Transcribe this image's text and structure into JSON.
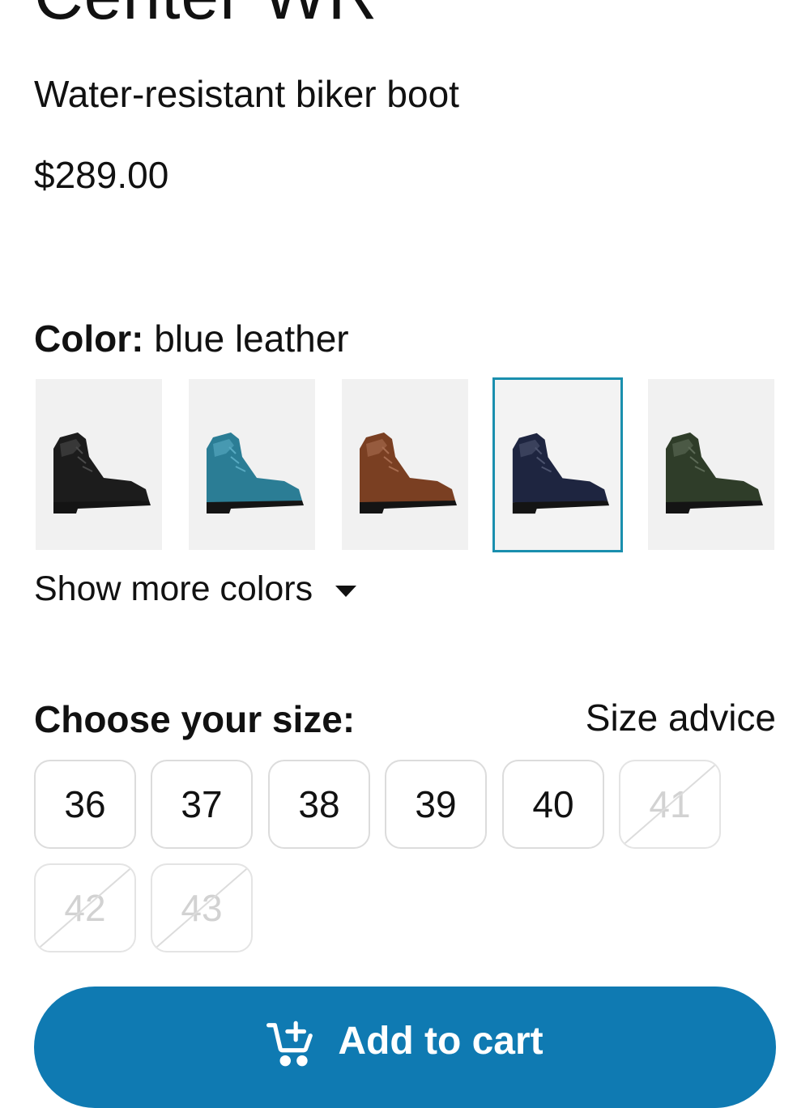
{
  "product": {
    "title": "Center WR",
    "subtitle": "Water-resistant biker boot",
    "price": "$289.00"
  },
  "color": {
    "label": "Color:",
    "selected": "blue leather",
    "swatches": [
      {
        "name": "black leather",
        "color": "#1c1c1c",
        "selected": false
      },
      {
        "name": "petrol leather",
        "color": "#2b7d95",
        "selected": false
      },
      {
        "name": "brown leather",
        "color": "#7a3f22",
        "selected": false
      },
      {
        "name": "blue leather",
        "color": "#1e2540",
        "selected": true
      },
      {
        "name": "green leather",
        "color": "#2f3d29",
        "selected": false
      }
    ],
    "show_more": "Show more colors",
    "accent": "#1a8fae"
  },
  "size": {
    "heading": "Choose your size:",
    "advice": "Size advice",
    "options": [
      {
        "label": "36",
        "available": true
      },
      {
        "label": "37",
        "available": true
      },
      {
        "label": "38",
        "available": true
      },
      {
        "label": "39",
        "available": true
      },
      {
        "label": "40",
        "available": true
      },
      {
        "label": "41",
        "available": false
      },
      {
        "label": "42",
        "available": false
      },
      {
        "label": "43",
        "available": false
      }
    ]
  },
  "cart": {
    "label": "Add to cart",
    "icon": "add-to-cart-icon",
    "color": "#0f7ab2"
  }
}
